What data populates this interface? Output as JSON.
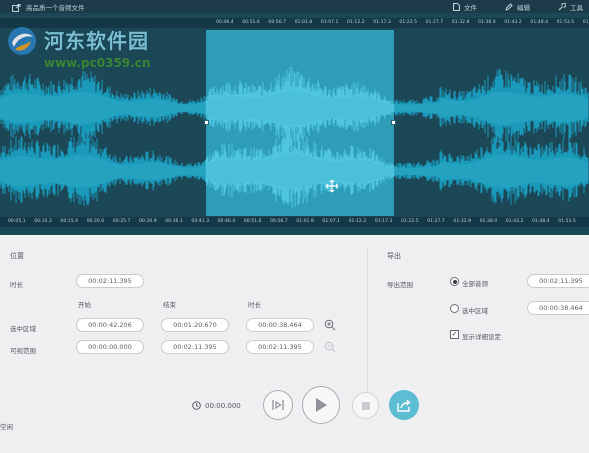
{
  "titlebar": {
    "title": "高品质一个音频文件",
    "items": [
      {
        "label": "文件",
        "icon": "document-icon"
      },
      {
        "label": "编辑",
        "icon": "pencil-icon"
      },
      {
        "label": "工具",
        "icon": "wrench-icon"
      }
    ]
  },
  "watermark": {
    "name": "河东软件园",
    "url": "www.pc0359.cn"
  },
  "ruler_top": [
    "00:46.4",
    "00:51.6",
    "00:56.7",
    "01:01.8",
    "01:07.1",
    "01:12.2",
    "01:17.3",
    "01:22.5",
    "01:27.7",
    "01:32.8",
    "01:38.0",
    "01:43.2",
    "01:48.4",
    "01:53.5",
    "01:58.7"
  ],
  "ruler_bottom": [
    "00:05.1",
    "00:10.3",
    "00:15.4",
    "00:20.6",
    "00:25.7",
    "00:30.9",
    "00:36.1",
    "00:41.3",
    "00:46.4",
    "00:51.6",
    "00:56.7",
    "01:01.9",
    "01:07.1",
    "01:12.2",
    "01:17.3",
    "01:22.5",
    "01:27.7",
    "01:32.9",
    "01:38.0",
    "01:43.2",
    "01:48.4",
    "01:53.5"
  ],
  "colors": {
    "editor_bg": "#1c4756",
    "wave": "#1a9fc0",
    "selection": "#4ec6df",
    "accent": "#5cbcd2"
  },
  "position": {
    "title": "位置",
    "duration_label": "时长",
    "duration_value": "00:02:11.395",
    "col_start": "开始",
    "col_end": "结束",
    "col_length": "时长",
    "selected_label": "选中区域",
    "selected_start": "00:00:42.206",
    "selected_end": "00:01:20.670",
    "selected_length": "00:00:38.464",
    "visible_label": "可视范围",
    "visible_start": "00:00:00.000",
    "visible_end": "00:02:11.395",
    "visible_length": "00:02:11.395"
  },
  "export": {
    "title": "导出",
    "range_label": "导出范围",
    "option_all": "全部音频",
    "option_all_value": "00:02:11.395",
    "option_selected": "选中区域",
    "option_selected_value": "00:00:38.464",
    "show_detail": "显示详细设定"
  },
  "transport": {
    "time": "00:00.000"
  },
  "status": {
    "text": "空闲"
  }
}
